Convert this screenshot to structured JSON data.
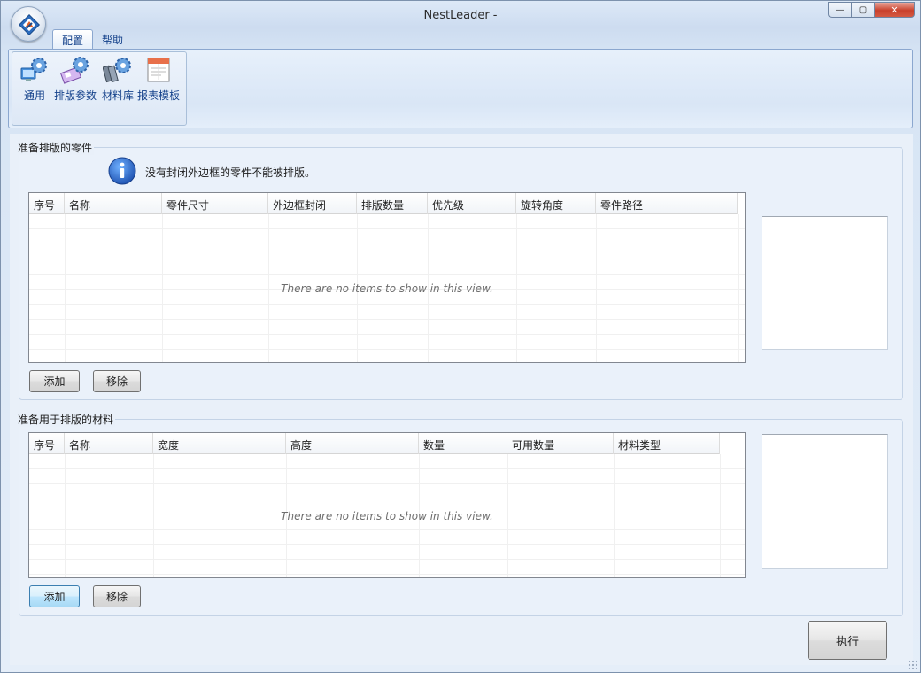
{
  "window": {
    "title": "NestLeader -",
    "controls": {
      "minimize": "—",
      "maximize": "▢",
      "close": "✕"
    }
  },
  "ribbon": {
    "tabs": [
      {
        "label": "配置",
        "active": true
      },
      {
        "label": "帮助",
        "active": false
      }
    ],
    "buttons": [
      {
        "label": "通用",
        "icon": "gear-monitor-icon"
      },
      {
        "label": "排版参数",
        "icon": "gear-layout-icon"
      },
      {
        "label": "材料库",
        "icon": "gear-books-icon"
      },
      {
        "label": "报表模板",
        "icon": "report-template-icon"
      }
    ]
  },
  "parts_group": {
    "title": "准备排版的零件",
    "info_text": "没有封闭外边框的零件不能被排版。",
    "columns": [
      "序号",
      "名称",
      "零件尺寸",
      "外边框封闭",
      "排版数量",
      "优先级",
      "旋转角度",
      "零件路径"
    ],
    "empty_text": "There are no items to show in this view.",
    "add_label": "添加",
    "remove_label": "移除"
  },
  "materials_group": {
    "title": "准备用于排版的材料",
    "columns": [
      "序号",
      "名称",
      "宽度",
      "高度",
      "数量",
      "可用数量",
      "材料类型"
    ],
    "empty_text": "There are no items to show in this view.",
    "add_label": "添加",
    "remove_label": "移除"
  },
  "execute_label": "执行",
  "colors": {
    "ribbon_text": "#15428b",
    "frame": "#7d92ad",
    "close_red": "#c9402b"
  }
}
